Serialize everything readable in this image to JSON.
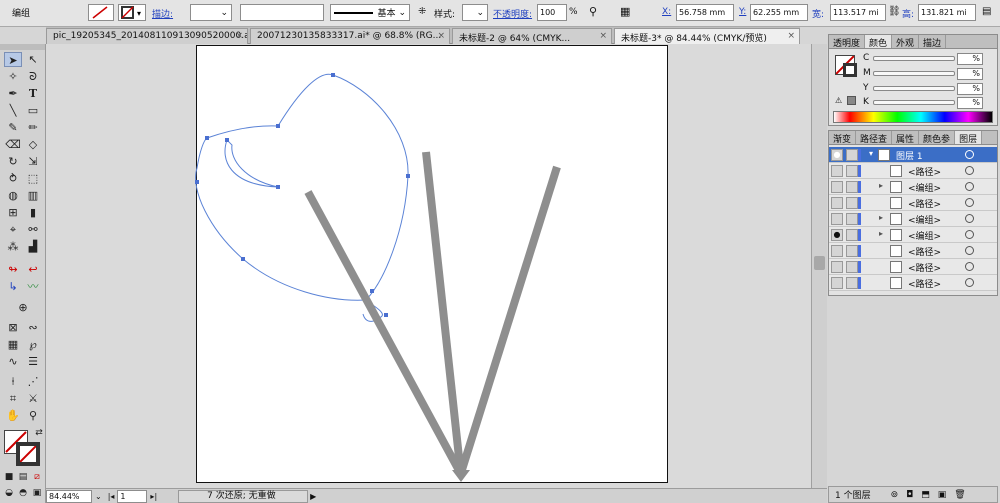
{
  "topbar": {
    "selection_label": "编组",
    "stroke_label": "描边:",
    "profile_label": "基本",
    "style_label": "样式:",
    "opacity_label": "不透明度:",
    "opacity_value": "100",
    "opacity_unit": "%",
    "x_label": "X:",
    "x_value": "56.758 mm",
    "y_label": "Y:",
    "y_value": "62.255 mm",
    "w_label": "宽:",
    "w_value": "113.517 mi",
    "h_label": "高:",
    "h_value": "131.821 mi"
  },
  "tabs": [
    {
      "label": "pic_19205345_201408110913090520000.ai*",
      "active": false
    },
    {
      "label": "20071230135833317.ai* @ 68.8% (RG...",
      "active": false
    },
    {
      "label": "未标题-2 @ 64% (CMYK...",
      "active": false
    },
    {
      "label": "未标题-3* @ 84.44% (CMYK/预览)",
      "active": true
    }
  ],
  "color_panel": {
    "tabs": [
      "透明度",
      "颜色",
      "外观",
      "描边"
    ],
    "channels": [
      {
        "name": "C",
        "value": "%"
      },
      {
        "name": "M",
        "value": "%"
      },
      {
        "name": "Y",
        "value": "%"
      },
      {
        "name": "K",
        "value": "%"
      }
    ]
  },
  "layers_panel": {
    "tabs": [
      "渐变",
      "路径查",
      "属性",
      "颜色参",
      "图层"
    ],
    "layers": [
      {
        "name": "图层 1",
        "selected": true,
        "expandable": true,
        "eye": true
      },
      {
        "name": "<路径>",
        "selected": false,
        "expandable": false,
        "eye": false
      },
      {
        "name": "<编组>",
        "selected": false,
        "expandable": true,
        "eye": false
      },
      {
        "name": "<路径>",
        "selected": false,
        "expandable": false,
        "eye": false
      },
      {
        "name": "<编组>",
        "selected": false,
        "expandable": true,
        "eye": false
      },
      {
        "name": "<编组>",
        "selected": false,
        "expandable": true,
        "eye": true
      },
      {
        "name": "<路径>",
        "selected": false,
        "expandable": false,
        "eye": false
      },
      {
        "name": "<路径>",
        "selected": false,
        "expandable": false,
        "eye": false
      },
      {
        "name": "<路径>",
        "selected": false,
        "expandable": false,
        "eye": false
      }
    ],
    "footer_label": "1 个图层"
  },
  "status": {
    "zoom": "84.44%",
    "page": "1",
    "undo_label": "7 次还原; 无重做"
  },
  "colors": {
    "selection_blue": "#3b6ec6",
    "guide_blue": "#5b83d6",
    "stick_gray": "#8e8e8e"
  }
}
